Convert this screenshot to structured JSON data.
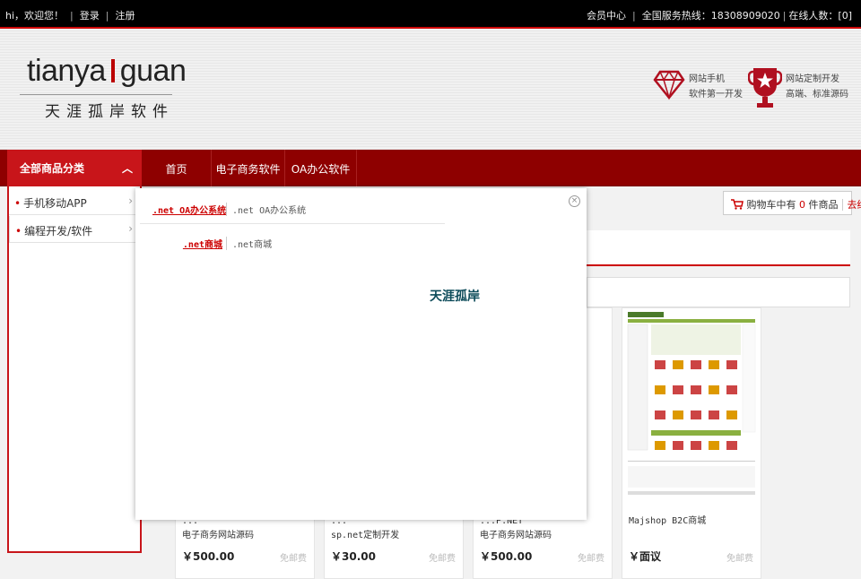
{
  "topbar": {
    "greeting": "hi，欢迎您！",
    "login": "登录",
    "register": "注册",
    "member_center": "会员中心",
    "hotline": "全国服务热线：18308909020",
    "online": "在线人数：[0]"
  },
  "logo": {
    "en_left": "tianya",
    "en_right": "guan",
    "cn": "天涯孤岸软件"
  },
  "promos": [
    {
      "line1": "网站手机",
      "line2": "软件第一开发",
      "icon": "diamond-icon"
    },
    {
      "line1": "网站定制开发",
      "line2": "高端、标准源码",
      "icon": "trophy-icon"
    }
  ],
  "nav": {
    "category_label": "全部商品分类",
    "items": [
      "首页",
      "电子商务软件",
      "OA办公软件"
    ]
  },
  "sidebar": {
    "items": [
      "手机移动APP",
      "编程开发/软件"
    ]
  },
  "cart": {
    "prefix": "购物车中有",
    "count": "0",
    "suffix": "件商品",
    "checkout": "去结算"
  },
  "popup": {
    "rows": [
      {
        "key": ".net OA办公系统",
        "value": ".net OA办公系统"
      },
      {
        "key": ".net商城",
        "value": ".net商城"
      }
    ],
    "brand_text": "天涯孤岸",
    "close": "×"
  },
  "products": [
    {
      "name1": "...",
      "name2": "电子商务网站源码",
      "price": "￥500.00",
      "shipping": "免邮费"
    },
    {
      "name1": "...",
      "name2": "sp.net定制开发",
      "price": "￥30.00",
      "shipping": "免邮费"
    },
    {
      "name1": "...P.NET",
      "name2": "电子商务网站源码",
      "price": "￥500.00",
      "shipping": "免邮费"
    },
    {
      "name1": "Majshop B2C商城",
      "name2": "",
      "price": "￥面议",
      "shipping": "免邮费"
    }
  ],
  "colors": {
    "nav_bg": "#8e0000",
    "category_bg": "#c8151a",
    "accent": "#cc0000"
  }
}
